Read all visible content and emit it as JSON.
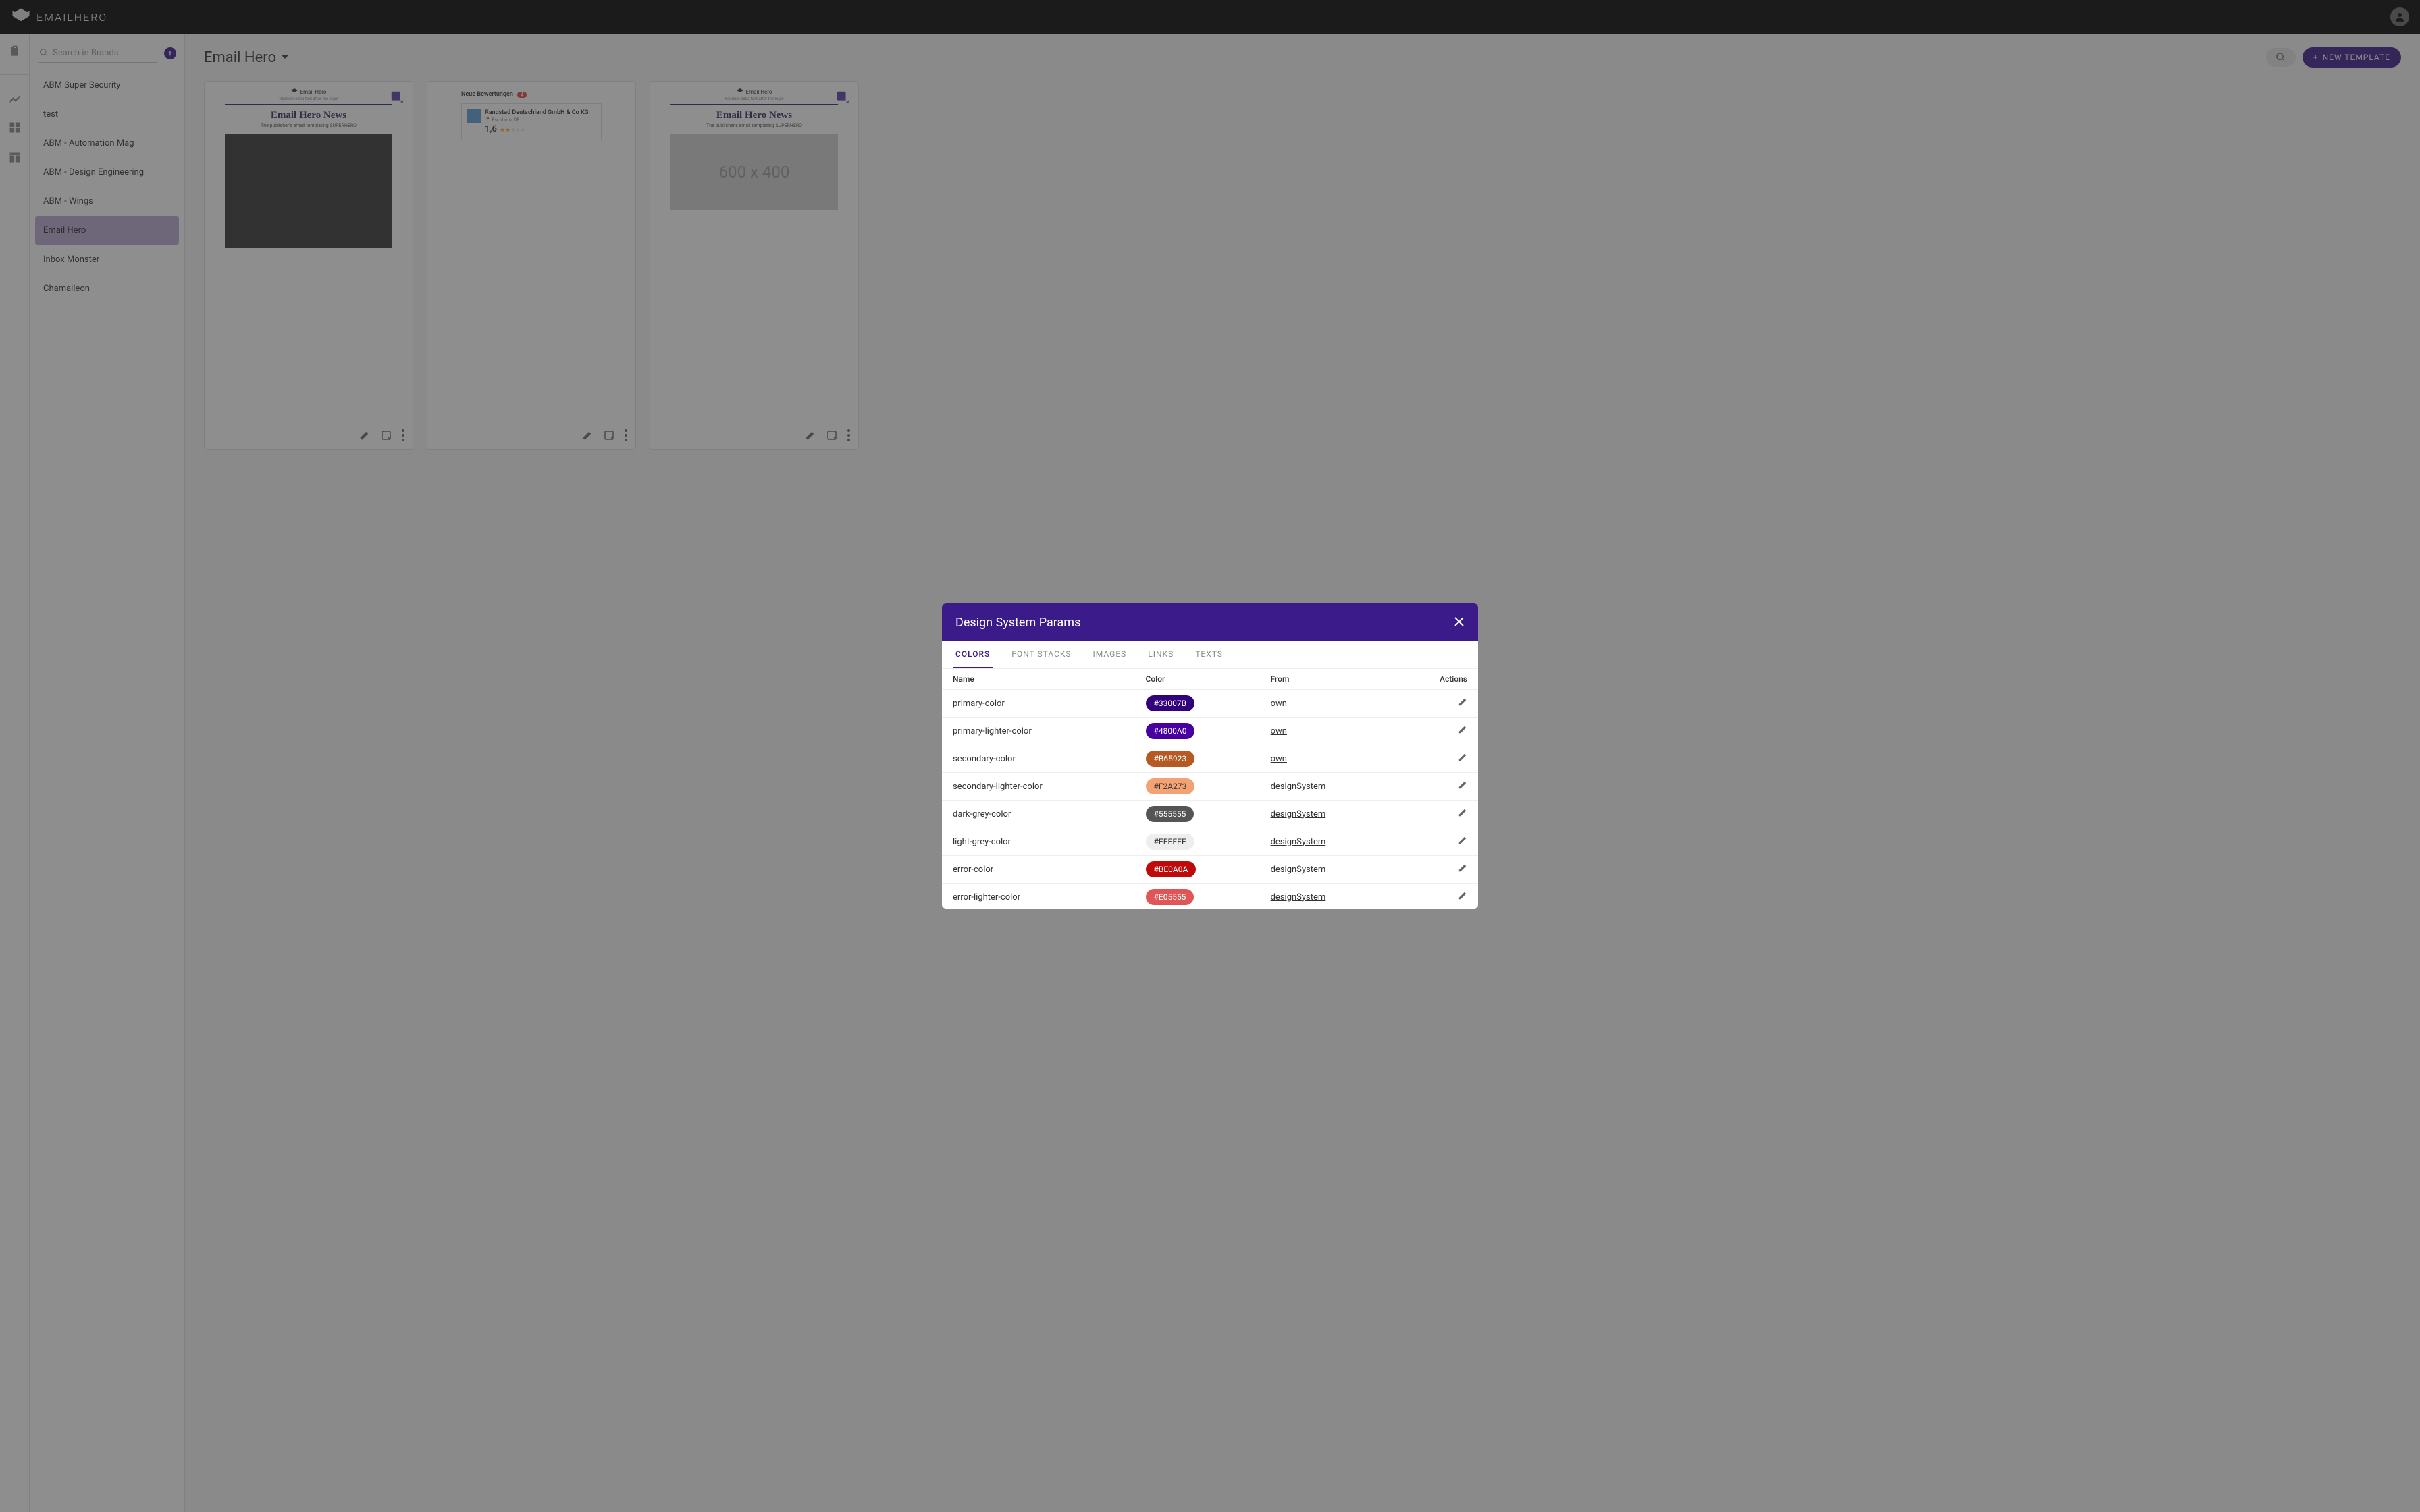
{
  "app": {
    "name": "EMAILHERO"
  },
  "search": {
    "placeholder": "Search in Brands"
  },
  "brands": [
    {
      "label": "ABM Super Security"
    },
    {
      "label": "test"
    },
    {
      "label": "ABM - Automation Mag"
    },
    {
      "label": "ABM - Design Engineering"
    },
    {
      "label": "ABM - Wings"
    },
    {
      "label": "Email Hero",
      "active": true
    },
    {
      "label": "Inbox Monster"
    },
    {
      "label": "Chamaileon"
    }
  ],
  "content": {
    "title": "Email Hero",
    "new_template": "NEW TEMPLATE"
  },
  "templates": [
    {
      "logo": "Email Hero",
      "extra": "Random extra text after the logo!",
      "title": "Email Hero News",
      "sub": "The publisher's email templating SUPERHERO",
      "badge": true
    },
    {
      "header": "Neue Bewertungen",
      "count": "4",
      "company": "Randstad Deutschland GmbH & Co KG",
      "loc": "Eschborn, DE",
      "score": "1,6"
    },
    {
      "logo": "Email Hero",
      "extra": "Random extra text after the logo!",
      "title": "Email Hero News",
      "sub": "The publisher's email templating SUPERHERO",
      "placeholder": "600 x 400",
      "badge": true
    }
  ],
  "modal": {
    "title": "Design System Params",
    "tabs": [
      "COLORS",
      "FONT STACKS",
      "IMAGES",
      "LINKS",
      "TEXTS"
    ],
    "active_tab": "COLORS",
    "columns": {
      "name": "Name",
      "color": "Color",
      "from": "From",
      "actions": "Actions"
    },
    "rows": [
      {
        "name": "primary-color",
        "hex": "#33007B",
        "from": "own",
        "light": false
      },
      {
        "name": "primary-lighter-color",
        "hex": "#4800A0",
        "from": "own",
        "light": false
      },
      {
        "name": "secondary-color",
        "hex": "#B65923",
        "from": "own",
        "light": false
      },
      {
        "name": "secondary-lighter-color",
        "hex": "#F2A273",
        "from": "designSystem",
        "light": true
      },
      {
        "name": "dark-grey-color",
        "hex": "#555555",
        "from": "designSystem",
        "light": false
      },
      {
        "name": "light-grey-color",
        "hex": "#EEEEEE",
        "from": "designSystem",
        "light": true
      },
      {
        "name": "error-color",
        "hex": "#BE0A0A",
        "from": "designSystem",
        "light": false
      },
      {
        "name": "error-lighter-color",
        "hex": "#E05555",
        "from": "designSystem",
        "light": false
      }
    ]
  }
}
